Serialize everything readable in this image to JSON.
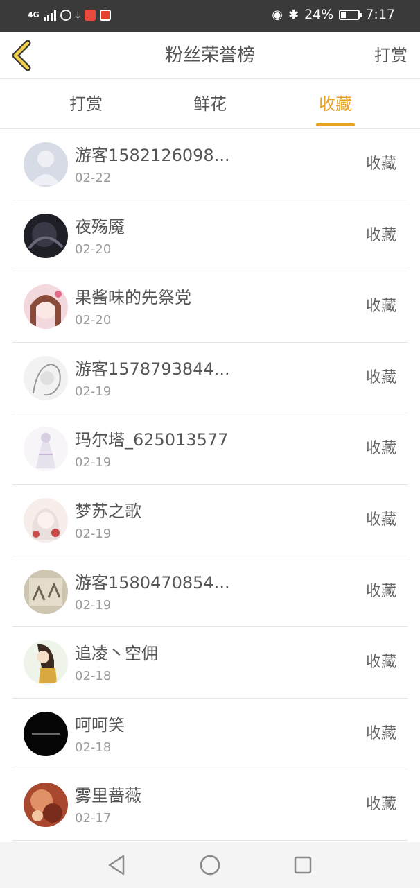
{
  "status_bar": {
    "network": "4G",
    "battery": "24%",
    "time": "7:17",
    "icons": [
      "signal-icon",
      "browser-icon",
      "download-icon",
      "video-app-icon",
      "calendar-app-icon",
      "eye-icon",
      "bluetooth-icon",
      "battery-icon"
    ]
  },
  "header": {
    "title": "粉丝荣誉榜",
    "action": "打赏",
    "back_icon": "chevron-left-icon",
    "accent_color": "#e8a323"
  },
  "tabs": [
    {
      "label": "打赏",
      "active": false
    },
    {
      "label": "鲜花",
      "active": false
    },
    {
      "label": "收藏",
      "active": true
    }
  ],
  "list": [
    {
      "name": "游客1582126098...",
      "date": "02-22",
      "action": "收藏"
    },
    {
      "name": "夜殇魇",
      "date": "02-20",
      "action": "收藏"
    },
    {
      "name": "果酱味的先祭党",
      "date": "02-20",
      "action": "收藏"
    },
    {
      "name": "游客1578793844...",
      "date": "02-19",
      "action": "收藏"
    },
    {
      "name": "玛尔塔_625013577",
      "date": "02-19",
      "action": "收藏"
    },
    {
      "name": "梦苏之歌",
      "date": "02-19",
      "action": "收藏"
    },
    {
      "name": "游客1580470854...",
      "date": "02-19",
      "action": "收藏"
    },
    {
      "name": "追凌丶空佣",
      "date": "02-18",
      "action": "收藏"
    },
    {
      "name": "呵呵笑",
      "date": "02-18",
      "action": "收藏"
    },
    {
      "name": "雾里蔷薇",
      "date": "02-17",
      "action": "收藏"
    }
  ],
  "nav": {
    "icons": [
      "back-triangle-icon",
      "home-circle-icon",
      "recents-square-icon"
    ]
  }
}
